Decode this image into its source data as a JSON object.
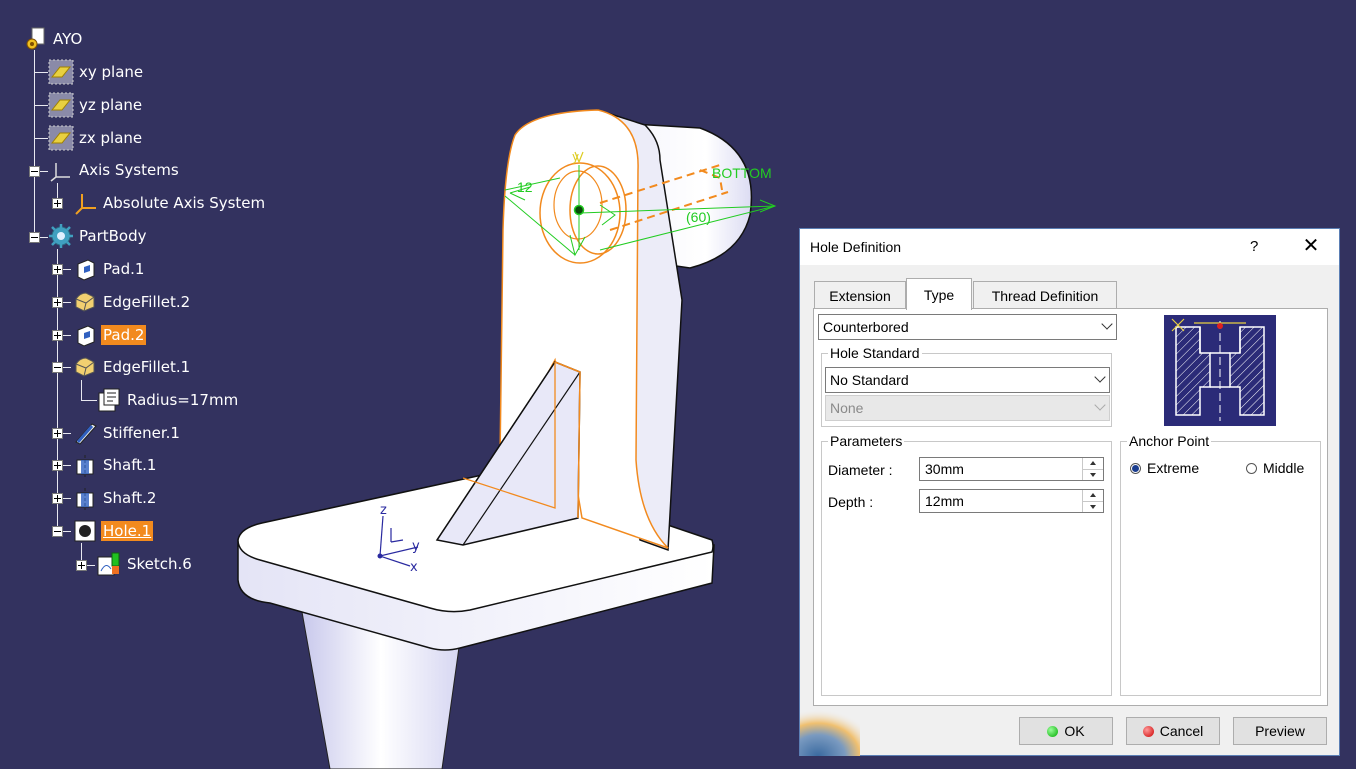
{
  "tree": {
    "root": "AYO",
    "planes": [
      "xy plane",
      "yz plane",
      "zx plane"
    ],
    "axis_systems": "Axis Systems",
    "absolute_axis": "Absolute Axis System",
    "part_body": "PartBody",
    "pad1": "Pad.1",
    "edgefillet2": "EdgeFillet.2",
    "pad2": "Pad.2",
    "edgefillet1": "EdgeFillet.1",
    "radius": "Radius=17mm",
    "stiffener1": "Stiffener.1",
    "shaft1": "Shaft.1",
    "shaft2": "Shaft.2",
    "hole1": "Hole.1",
    "sketch6": "Sketch.6"
  },
  "viewport": {
    "label_bottom": "BOTTOM",
    "dim_12": "12",
    "dim_60": "(60)",
    "axis_z": "z",
    "axis_y": "y",
    "axis_x": "x",
    "axis_y_top": "y"
  },
  "dialog": {
    "title": "Hole Definition",
    "help": "?",
    "close": "✕",
    "tabs": [
      "Extension",
      "Type",
      "Thread Definition"
    ],
    "hole_type": "Counterbored",
    "hole_standard_label": "Hole Standard",
    "hole_standard": "No Standard",
    "standard_sub": "None",
    "parameters_label": "Parameters",
    "diameter_label": "Diameter :",
    "diameter_value": "30mm",
    "depth_label": "Depth :",
    "depth_value": "12mm",
    "anchor_label": "Anchor Point",
    "anchor_extreme": "Extreme",
    "anchor_middle": "Middle",
    "ok": "OK",
    "cancel": "Cancel",
    "preview": "Preview"
  },
  "colors": {
    "background": "#33325f",
    "highlight": "#f28a1e",
    "selection_edges": "#f28a1e",
    "constraint_green": "#22cc22"
  }
}
